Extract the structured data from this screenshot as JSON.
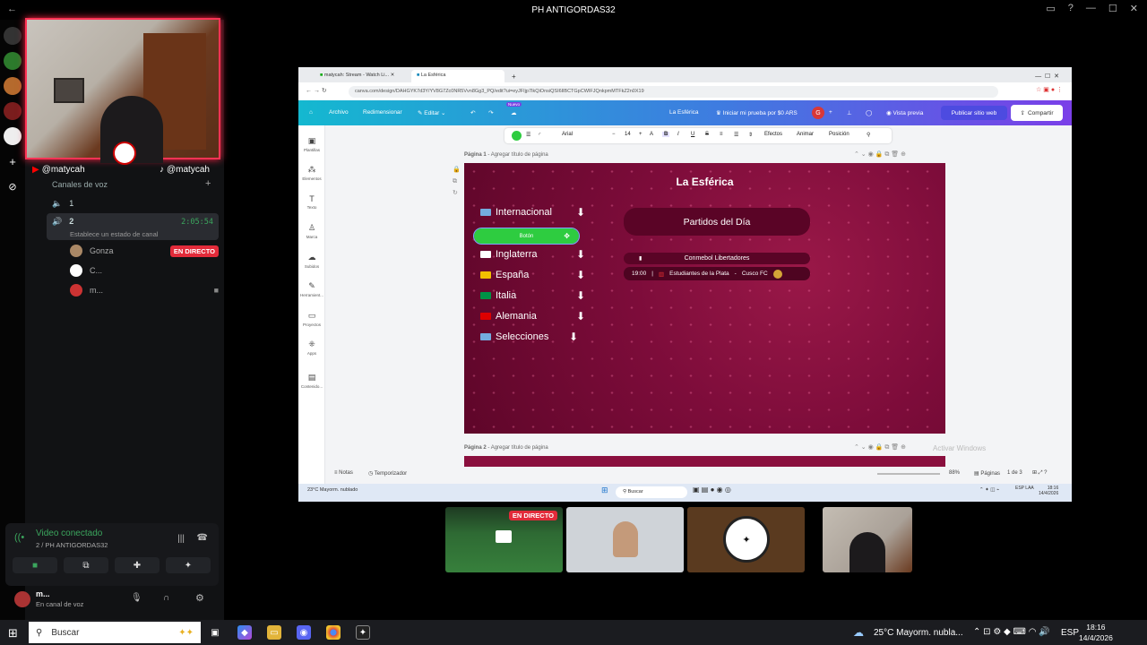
{
  "window_title": "PH ANTIGORDAS32",
  "discord": {
    "handle_left": "@matycah",
    "handle_right": "@matycah",
    "section": "Canales de voz",
    "channel_1": "1",
    "channel_2": "2",
    "channel_2_time": "2:05:54",
    "channel_status": "Establece un estado de canal",
    "users": [
      {
        "name": "Gonza",
        "badge": "EN DIRECTO"
      },
      {
        "name": "C..."
      },
      {
        "name": "m..."
      }
    ],
    "voice_status": "Video conectado",
    "voice_server": "2 / PH ANTIGORDAS32",
    "user_name": "m...",
    "user_status": "En canal de voz",
    "tile_live_badge": "EN DIRECTO"
  },
  "browser": {
    "tabs": [
      "matycah: Stream - Watch Li...",
      "La Esférica"
    ],
    "url": "canva.com/design/DAHGYK7d3Y/YV8G7Zc0NR5Vvn8Gg3_PQ/edit?ui=eyJFIjp7IkQiOnsiQSI6IlBCTGpCWIFJQnkpmMTFkZ2n0X19",
    "canva": {
      "file": "Archivo",
      "resize": "Redimensionar",
      "edit": "Editar",
      "new_badge": "Nuevo",
      "doc_title": "La Esférica",
      "trial": "Iniciar mi prueba por $0 ARS",
      "avatar_letter": "G",
      "preview": "Vista previa",
      "publish": "Publicar sitio web",
      "share": "Compartir",
      "rail": [
        "Plantillas",
        "Elementos",
        "Texto",
        "Marca",
        "Subidos",
        "Herramient...",
        "Proyectos",
        "Apps",
        "Contenido..."
      ],
      "font": "Arial",
      "font_size": "14",
      "effects": "Efectos",
      "animate": "Animar",
      "position": "Posición",
      "page1_label": "Página 1",
      "page2_label": "Página 2",
      "page_title_hint": "- Agregar título de página",
      "notes": "Notas",
      "timer": "Temporizador",
      "zoom": "88%",
      "pages": "Páginas",
      "page_count": "1 de 3",
      "watermark": "Activar Windows"
    },
    "inner_taskbar": {
      "search": "Buscar",
      "weather": "23°C",
      "weather_desc": "Mayorm. nublado",
      "lang": "ESP LAA",
      "time": "18:16",
      "date": "14/4/2026"
    }
  },
  "slide": {
    "title": "La Esférica",
    "menu": [
      {
        "label": "Internacional",
        "flag": "#74acdf"
      },
      {
        "label": "Inglaterra",
        "flag": "#ffffff"
      },
      {
        "label": "España",
        "flag": "#f1bf00"
      },
      {
        "label": "Italia",
        "flag": "#009246"
      },
      {
        "label": "Alemania",
        "flag": "#dd0000"
      },
      {
        "label": "Selecciones",
        "flag": "#74acdf"
      }
    ],
    "button_label": "Botón",
    "partidos": "Partidos del Día",
    "competition": "Conmebol Libertadores",
    "match_time": "19:00",
    "home": "Estudiantes de la Plata",
    "separator": "-",
    "away": "Cusco FC"
  },
  "taskbar": {
    "search": "Buscar",
    "weather": "25°C",
    "weather_desc": "Mayorm. nubla...",
    "lang": "ESP",
    "time": "18:16",
    "date": "14/4/2026"
  },
  "colors": {
    "slide_bg": "#7d0c3a",
    "button_green": "#2ecc40",
    "live_red": "#e22b3a",
    "canva_gradient_start": "#14b8d0",
    "canva_gradient_end": "#7a3fe8"
  }
}
